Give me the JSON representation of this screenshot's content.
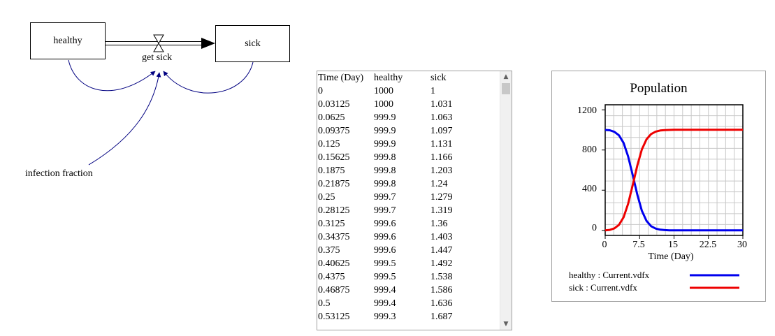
{
  "diagram": {
    "stock_healthy": "healthy",
    "stock_sick": "sick",
    "flow_label": "get sick",
    "aux_label": "infection fraction",
    "arrow_color": "#000080"
  },
  "table": {
    "headers": [
      "Time (Day)",
      "healthy",
      "sick"
    ],
    "rows": [
      [
        "0",
        "1000",
        "1"
      ],
      [
        "0.03125",
        "1000",
        "1.031"
      ],
      [
        "0.0625",
        "999.9",
        "1.063"
      ],
      [
        "0.09375",
        "999.9",
        "1.097"
      ],
      [
        "0.125",
        "999.9",
        "1.131"
      ],
      [
        "0.15625",
        "999.8",
        "1.166"
      ],
      [
        "0.1875",
        "999.8",
        "1.203"
      ],
      [
        "0.21875",
        "999.8",
        "1.24"
      ],
      [
        "0.25",
        "999.7",
        "1.279"
      ],
      [
        "0.28125",
        "999.7",
        "1.319"
      ],
      [
        "0.3125",
        "999.6",
        "1.36"
      ],
      [
        "0.34375",
        "999.6",
        "1.403"
      ],
      [
        "0.375",
        "999.6",
        "1.447"
      ],
      [
        "0.40625",
        "999.5",
        "1.492"
      ],
      [
        "0.4375",
        "999.5",
        "1.538"
      ],
      [
        "0.46875",
        "999.4",
        "1.586"
      ],
      [
        "0.5",
        "999.4",
        "1.636"
      ],
      [
        "0.53125",
        "999.3",
        "1.687"
      ]
    ],
    "scroll_up_icon": "triangle-up",
    "scroll_down_icon": "triangle-down"
  },
  "chart_data": {
    "type": "line",
    "title": "Population",
    "xlabel": "Time (Day)",
    "ylabel": "",
    "xlim": [
      0,
      30
    ],
    "ylim": [
      -50,
      1250
    ],
    "x_ticks": [
      "0",
      "7.5",
      "15",
      "22.5",
      "30"
    ],
    "y_ticks": [
      "1200",
      "800",
      "400",
      "0"
    ],
    "grid": true,
    "legend_position": "bottom",
    "x": [
      0,
      1,
      2,
      3,
      4,
      5,
      6,
      7,
      8,
      9,
      10,
      11,
      12,
      13,
      14,
      15,
      18,
      21,
      24,
      27,
      30
    ],
    "series": [
      {
        "name": "healthy : Current.vdfx",
        "color": "#0000ee",
        "values": [
          1000,
          996,
          981,
          946,
          871,
          737,
          550,
          355,
          195,
          95,
          42,
          18,
          7,
          3,
          1,
          0,
          0,
          0,
          0,
          0,
          0
        ]
      },
      {
        "name": "sick : Current.vdfx",
        "color": "#ee0000",
        "values": [
          1,
          5,
          20,
          55,
          130,
          264,
          451,
          646,
          806,
          906,
          959,
          983,
          994,
          998,
          1000,
          1001,
          1001,
          1001,
          1001,
          1001,
          1001
        ]
      }
    ]
  }
}
